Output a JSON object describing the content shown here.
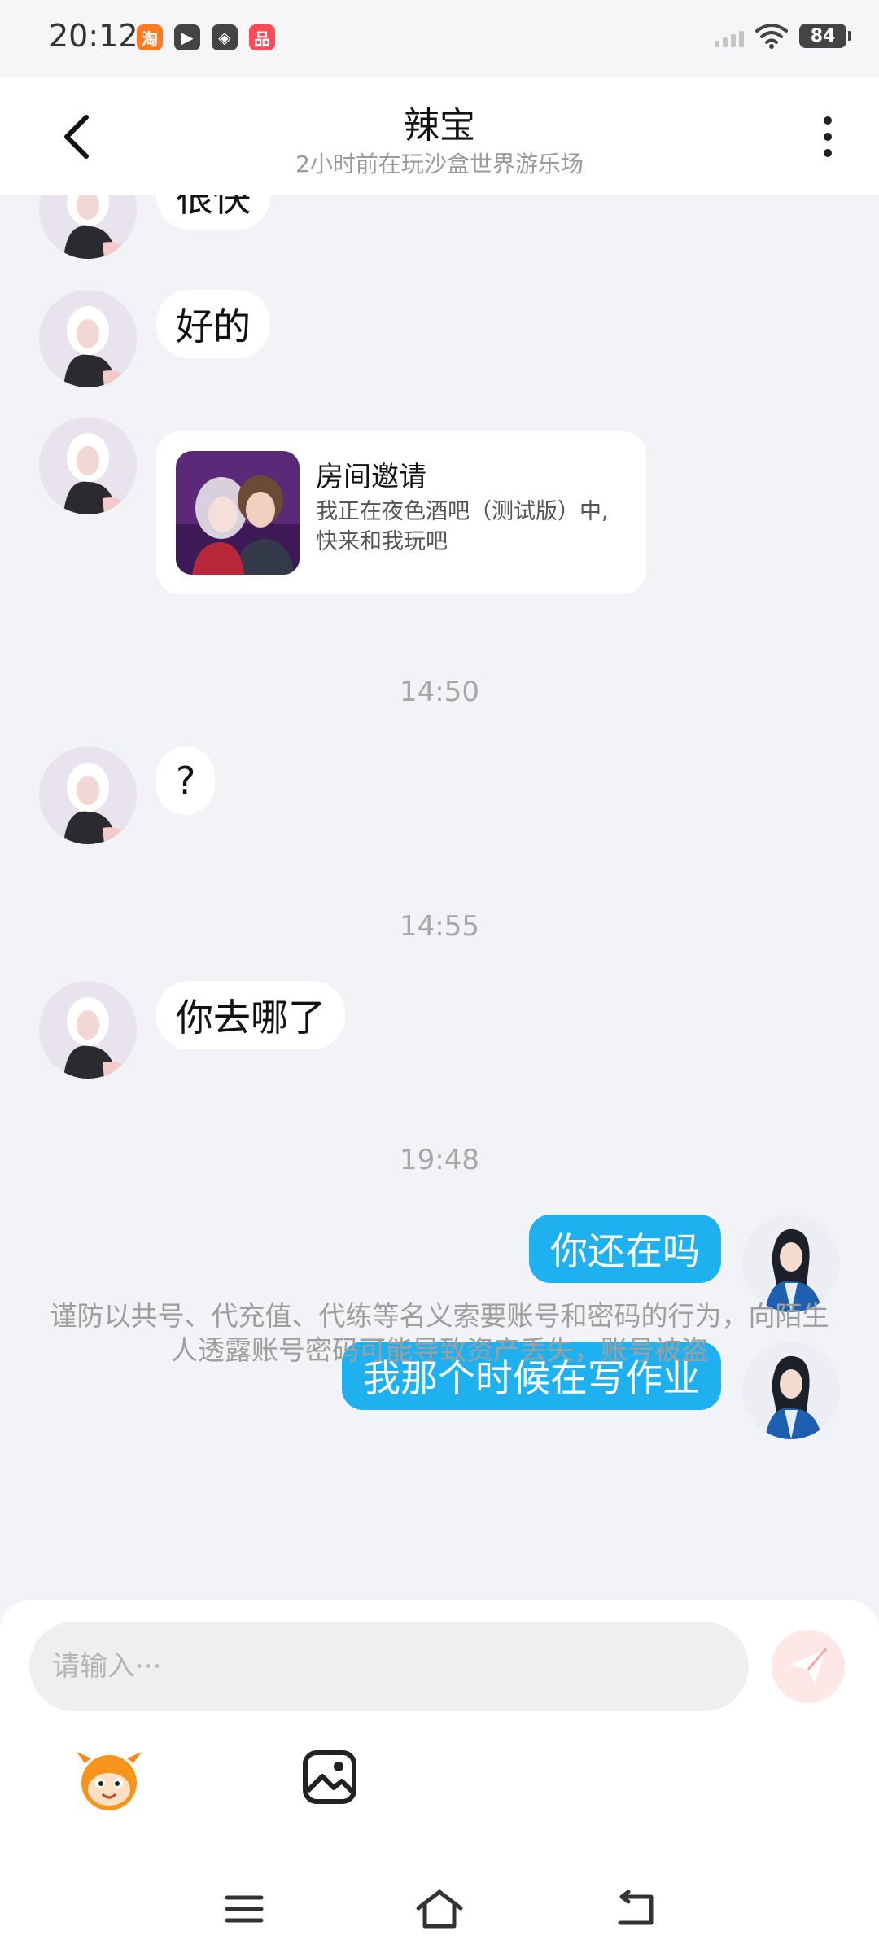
{
  "status_bar": {
    "time": "20:12",
    "battery": "84",
    "app_icons": [
      {
        "name": "taobao-icon",
        "glyph": "淘",
        "color": "#ff7a20"
      },
      {
        "name": "video-icon",
        "glyph": "▶",
        "color": "#444444"
      },
      {
        "name": "leaf-icon",
        "glyph": "◈",
        "color": "#444444"
      },
      {
        "name": "shop-icon",
        "glyph": "品",
        "color": "#ff4a5a"
      }
    ]
  },
  "header": {
    "title": "辣宝",
    "subtitle": "2小时前在玩沙盒世界游乐场"
  },
  "messages": {
    "partial_top": "很快",
    "msg_ok": "好的",
    "invite": {
      "title": "房间邀请",
      "description": "我正在夜色酒吧（测试版）中, 快来和我玩吧"
    },
    "ts_1": "14:50",
    "msg_question": "?",
    "ts_2": "14:55",
    "msg_where": "你去哪了",
    "ts_3": "19:48",
    "out_1": "你还在吗",
    "out_2": "我那个时候在写作业"
  },
  "notice": "谨防以共号、代充值、代练等名义索要账号和密码的行为，向陌生人透露账号密码可能导致资产丢失，账号被盗",
  "composer": {
    "placeholder": "请输入···"
  },
  "colors": {
    "outgoing_bubble": "#1fb0f0",
    "chat_background": "#f1f3f7",
    "send_button": "#f7a5a5"
  }
}
